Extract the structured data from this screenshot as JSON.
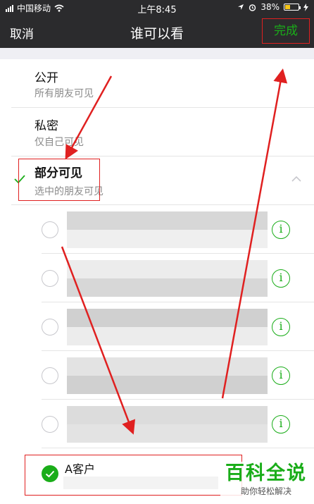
{
  "status_bar": {
    "carrier": "中国移动",
    "time": "上午8:45",
    "battery_percent": "38%",
    "battery_level": 0.38
  },
  "nav": {
    "cancel_label": "取消",
    "title": "谁可以看",
    "done_label": "完成"
  },
  "options": [
    {
      "title": "公开",
      "subtitle": "所有朋友可见"
    },
    {
      "title": "私密",
      "subtitle": "仅自己可见"
    },
    {
      "title": "部分可见",
      "subtitle": "选中的朋友可见",
      "selected": true
    }
  ],
  "tag_groups": [
    {
      "label": "A客户",
      "checked": true
    }
  ],
  "watermark": {
    "main": "百科全说",
    "sub": "助你轻松解决"
  },
  "colors": {
    "accent": "#1aad19",
    "annotation": "#e02020",
    "nav_background": "#2b2b2d"
  }
}
